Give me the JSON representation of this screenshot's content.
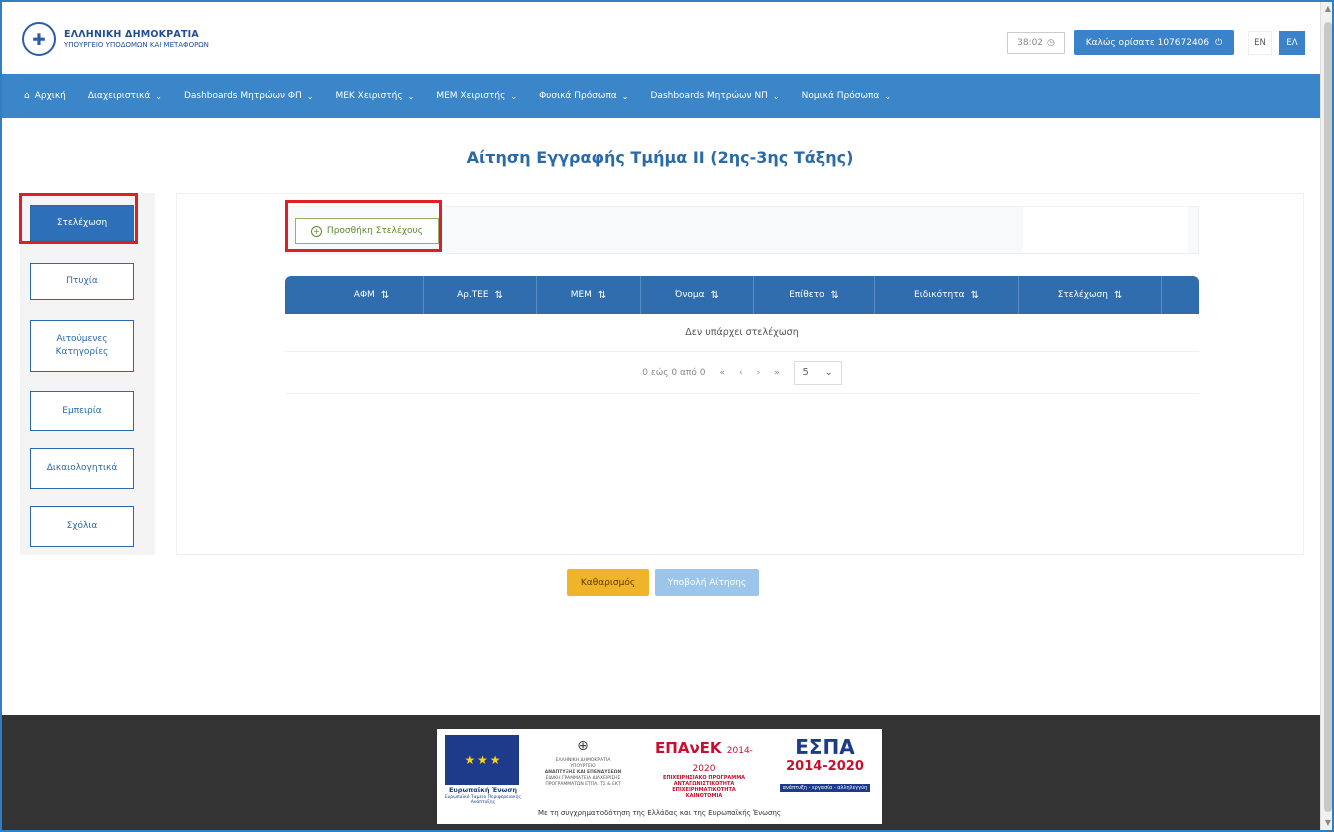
{
  "header": {
    "ministry_title": "ΕΛΛΗΝΙΚΗ ΔΗΜΟΚΡΑΤΙΑ",
    "ministry_subtitle": "ΥΠΟΥΡΓΕΙΟ ΥΠΟΔΟΜΩΝ ΚΑΙ ΜΕΤΑΦΟΡΩΝ",
    "clock": "38:02",
    "welcome": "Καλώς ορίσατε 107672406",
    "lang_en": "EN",
    "lang_el": "ΕΛ"
  },
  "nav": {
    "items": [
      {
        "label": "Αρχική"
      },
      {
        "label": "Διαχειριστικά"
      },
      {
        "label": "Dashboards Μητρώων ΦΠ"
      },
      {
        "label": "ΜΕΚ Χειριστής"
      },
      {
        "label": "ΜΕΜ Χειριστής"
      },
      {
        "label": "Φυσικά Πρόσωπα"
      },
      {
        "label": "Dashboards Μητρώων ΝΠ"
      },
      {
        "label": "Νομικά Πρόσωπα"
      }
    ]
  },
  "page": {
    "title": "Αίτηση Εγγραφής Τμήμα ΙΙ (2ης-3ης Τάξης)"
  },
  "sidebar": {
    "items": [
      {
        "label": "Στελέχωση"
      },
      {
        "label": "Πτυχία"
      },
      {
        "label": "Αιτούμενες Κατηγορίες"
      },
      {
        "label": "Εμπειρία"
      },
      {
        "label": "Δικαιολογητικά"
      },
      {
        "label": "Σχόλια"
      }
    ]
  },
  "toolbar": {
    "add_label": "Προσθήκη Στελέχους"
  },
  "table": {
    "columns": [
      "ΑΦΜ",
      "Αρ.ΤΕΕ",
      "ΜΕΜ",
      "Όνομα",
      "Επίθετο",
      "Ειδικότητα",
      "Στελέχωση"
    ],
    "empty_message": "Δεν υπάρχει στελέχωση",
    "pager_text": "0 εώς 0 από 0",
    "page_size": "5"
  },
  "actions": {
    "clear": "Καθαρισμός",
    "submit": "Υποβολή Αίτησης"
  },
  "footer": {
    "eu_label": "Ευρωπαϊκή Ένωση",
    "eu_fund": "Ευρωπαϊκό Ταμείο Περιφερειακής Ανάπτυξης",
    "gr_line1": "ΕΛΛΗΝΙΚΗ ΔΗΜΟΚΡΑΤΙΑ",
    "gr_line2": "ΥΠΟΥΡΓΕΙΟ",
    "gr_line3": "ΑΝΑΠΤΥΞΗΣ ΚΑΙ ΕΠΕΝΔΥΣΕΩΝ",
    "gr_line4": "ΕΙΔΙΚΗ ΓΡΑΜΜΑΤΕΙΑ ΔΙΑΧΕΙΡΙΣΗΣ ΠΡΟΓΡΑΜΜΑΤΩΝ ΕΤΠΑ, ΤΣ & ΕΚΤ",
    "epanek_title": "ΕΠΑνΕΚ",
    "epanek_years": "2014-2020",
    "epanek_l1": "ΕΠΙΧΕΙΡΗΣΙΑΚΟ ΠΡΟΓΡΑΜΜΑ",
    "epanek_l2": "ΑΝΤΑΓΩΝΙΣΤΙΚΟΤΗΤΑ",
    "epanek_l3": "ΕΠΙΧΕΙΡΗΜΑΤΙΚΟΤΗΤΑ",
    "epanek_l4": "ΚΑΙΝΟΤΟΜΙΑ",
    "espa_title": "ΕΣΠΑ",
    "espa_years": "2014-2020",
    "espa_tag": "ανάπτυξη - εργασία - αλληλεγγύη",
    "cofund": "Με τη συγχρηματοδότηση της Ελλάδας και της Ευρωπαϊκής Ένωσης"
  }
}
